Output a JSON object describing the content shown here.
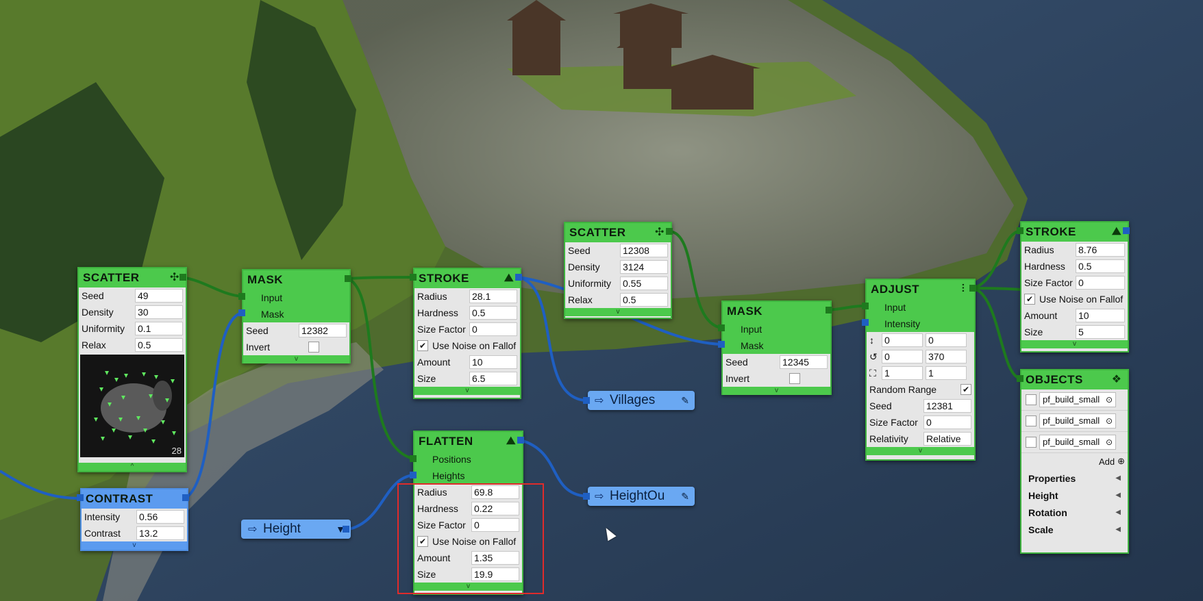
{
  "scatter1": {
    "title": "SCATTER",
    "icon": "scatter-icon",
    "rows": [
      {
        "label": "Seed",
        "value": "49"
      },
      {
        "label": "Density",
        "value": "30"
      },
      {
        "label": "Uniformity",
        "value": "0.1"
      },
      {
        "label": "Relax",
        "value": "0.5"
      }
    ],
    "preview_count": "28"
  },
  "mask1": {
    "title": "MASK",
    "ports": [
      "Input",
      "Mask"
    ],
    "seed_label": "Seed",
    "seed": "12382",
    "invert_label": "Invert"
  },
  "stroke1": {
    "title": "STROKE",
    "icon": "stroke-icon",
    "rows": [
      {
        "label": "Radius",
        "value": "28.1"
      },
      {
        "label": "Hardness",
        "value": "0.5"
      },
      {
        "label": "Size Factor",
        "value": "0"
      }
    ],
    "noise_label": "Use Noise on Fallof",
    "rows2": [
      {
        "label": "Amount",
        "value": "10"
      },
      {
        "label": "Size",
        "value": "6.5"
      }
    ]
  },
  "scatter2": {
    "title": "SCATTER",
    "icon": "scatter-icon",
    "rows": [
      {
        "label": "Seed",
        "value": "12308"
      },
      {
        "label": "Density",
        "value": "3124"
      },
      {
        "label": "Uniformity",
        "value": "0.55"
      },
      {
        "label": "Relax",
        "value": "0.5"
      }
    ]
  },
  "mask2": {
    "title": "MASK",
    "ports": [
      "Input",
      "Mask"
    ],
    "seed_label": "Seed",
    "seed": "12345",
    "invert_label": "Invert"
  },
  "adjust": {
    "title": "ADJUST",
    "icon": "sliders-icon",
    "ports": [
      "Input",
      "Intensity"
    ],
    "transform": [
      {
        "icon": "move-icon",
        "a": "0",
        "b": "0"
      },
      {
        "icon": "rotate-icon",
        "a": "0",
        "b": "370"
      },
      {
        "icon": "scale-icon",
        "a": "1",
        "b": "1"
      }
    ],
    "random_range_label": "Random Range",
    "seed_label": "Seed",
    "seed": "12381",
    "size_factor_label": "Size Factor",
    "size_factor": "0",
    "relativity_label": "Relativity",
    "relativity": "Relative"
  },
  "stroke2": {
    "title": "STROKE",
    "icon": "stroke-icon",
    "rows": [
      {
        "label": "Radius",
        "value": "8.76"
      },
      {
        "label": "Hardness",
        "value": "0.5"
      },
      {
        "label": "Size Factor",
        "value": "0"
      }
    ],
    "noise_label": "Use Noise on Fallof",
    "rows2": [
      {
        "label": "Amount",
        "value": "10"
      },
      {
        "label": "Size",
        "value": "5"
      }
    ]
  },
  "objects": {
    "title": "OBJECTS",
    "icon": "objects-icon",
    "items": [
      "pf_build_small",
      "pf_build_small",
      "pf_build_small"
    ],
    "add_label": "Add",
    "sections": [
      "Properties",
      "Height",
      "Rotation",
      "Scale"
    ]
  },
  "flatten": {
    "title": "FLATTEN",
    "icon": "flatten-icon",
    "ports": [
      "Positions",
      "Heights"
    ],
    "rows": [
      {
        "label": "Radius",
        "value": "69.8"
      },
      {
        "label": "Hardness",
        "value": "0.22"
      },
      {
        "label": "Size Factor",
        "value": "0"
      }
    ],
    "noise_label": "Use Noise on Fallof",
    "rows2": [
      {
        "label": "Amount",
        "value": "1.35"
      },
      {
        "label": "Size",
        "value": "19.9"
      }
    ]
  },
  "contrast": {
    "title": "CONTRAST",
    "rows": [
      {
        "label": "Intensity",
        "value": "0.56"
      },
      {
        "label": "Contrast",
        "value": "13.2"
      }
    ]
  },
  "height_input": {
    "label": "Height"
  },
  "villages_output": {
    "label": "Villages"
  },
  "heightout_output": {
    "label": "HeightOu"
  },
  "colors": {
    "node_green": "#4cc94c",
    "node_blue": "#5b9bef",
    "link_green": "#1e7a1e",
    "link_blue": "#1f5fc2",
    "selection_red": "#e02b2b"
  }
}
